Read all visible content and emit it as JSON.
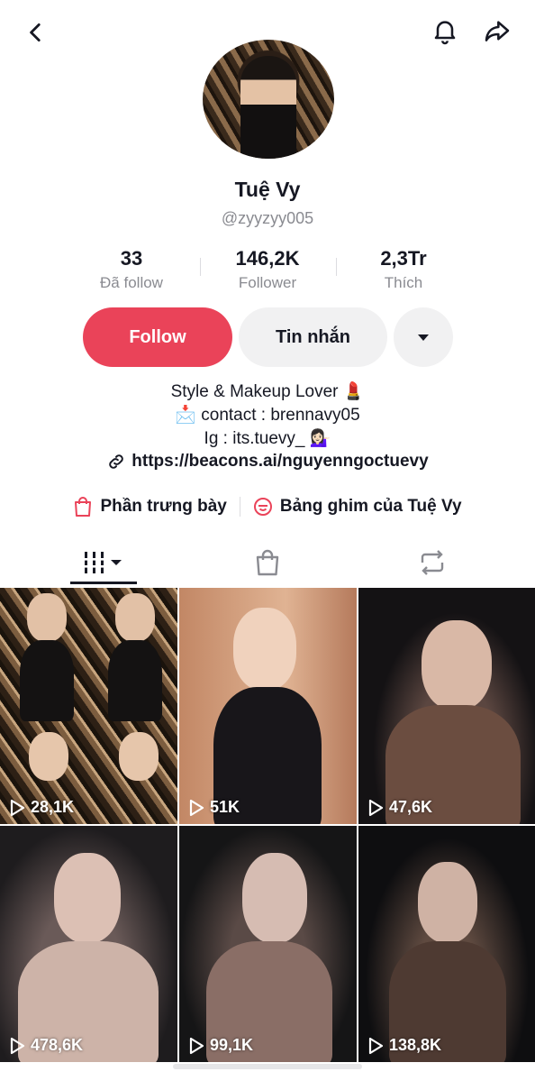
{
  "header": {
    "back_icon": "chevron-left-icon",
    "notification_icon": "bell-icon",
    "share_icon": "share-arrow-icon"
  },
  "profile": {
    "display_name": "Tuệ Vy",
    "handle": "@zyyzyy005"
  },
  "stats": [
    {
      "value": "33",
      "label": "Đã follow"
    },
    {
      "value": "146,2K",
      "label": "Follower"
    },
    {
      "value": "2,3Tr",
      "label": "Thích"
    }
  ],
  "actions": {
    "follow_label": "Follow",
    "message_label": "Tin nhắn",
    "more_icon": "caret-down-icon"
  },
  "bio": {
    "line1": "Style & Makeup Lover 💄",
    "line2": "📩 contact : brennavy05",
    "line3": "Ig : its.tuevy_ 💁🏻‍♀️",
    "link": "https://beacons.ai/nguyenngoctuevy"
  },
  "shelf": {
    "showcase_label": "Phần trưng bày",
    "pinned_label": "Bảng ghim của Tuệ Vy"
  },
  "tabs": {
    "videos_icon": "grid-columns-icon",
    "shop_icon": "shopping-bag-icon",
    "repost_icon": "repost-icon"
  },
  "videos": [
    {
      "views": "28,1K"
    },
    {
      "views": "51K"
    },
    {
      "views": "47,6K"
    },
    {
      "views": "478,6K"
    },
    {
      "views": "99,1K"
    },
    {
      "views": "138,8K"
    }
  ],
  "colors": {
    "accent": "#ea4359",
    "secondary_button": "#f1f1f2",
    "muted_text": "#8a8b91"
  }
}
